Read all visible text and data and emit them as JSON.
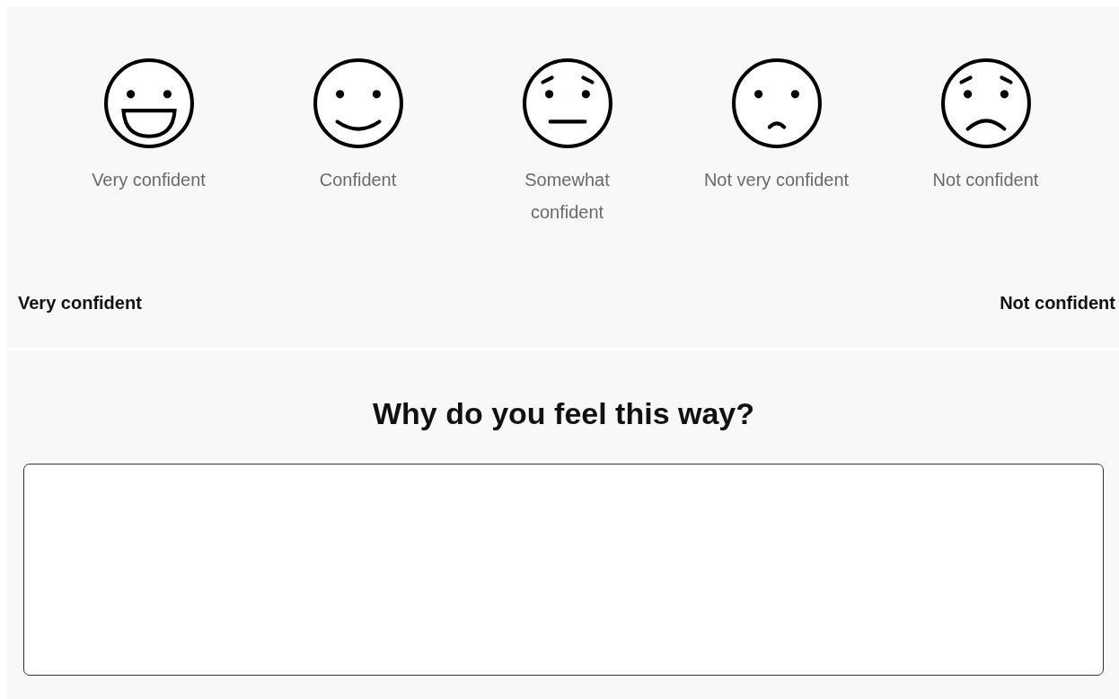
{
  "options": [
    {
      "kind": "grin",
      "label": "Very confident"
    },
    {
      "kind": "smile",
      "label": "Confident"
    },
    {
      "kind": "worried",
      "label": "Somewhat confident"
    },
    {
      "kind": "frown",
      "label": "Not very confident"
    },
    {
      "kind": "sad",
      "label": "Not confident"
    }
  ],
  "scale": {
    "left": "Very confident",
    "right": "Not confident"
  },
  "question": {
    "title": "Why do you feel this way?"
  }
}
